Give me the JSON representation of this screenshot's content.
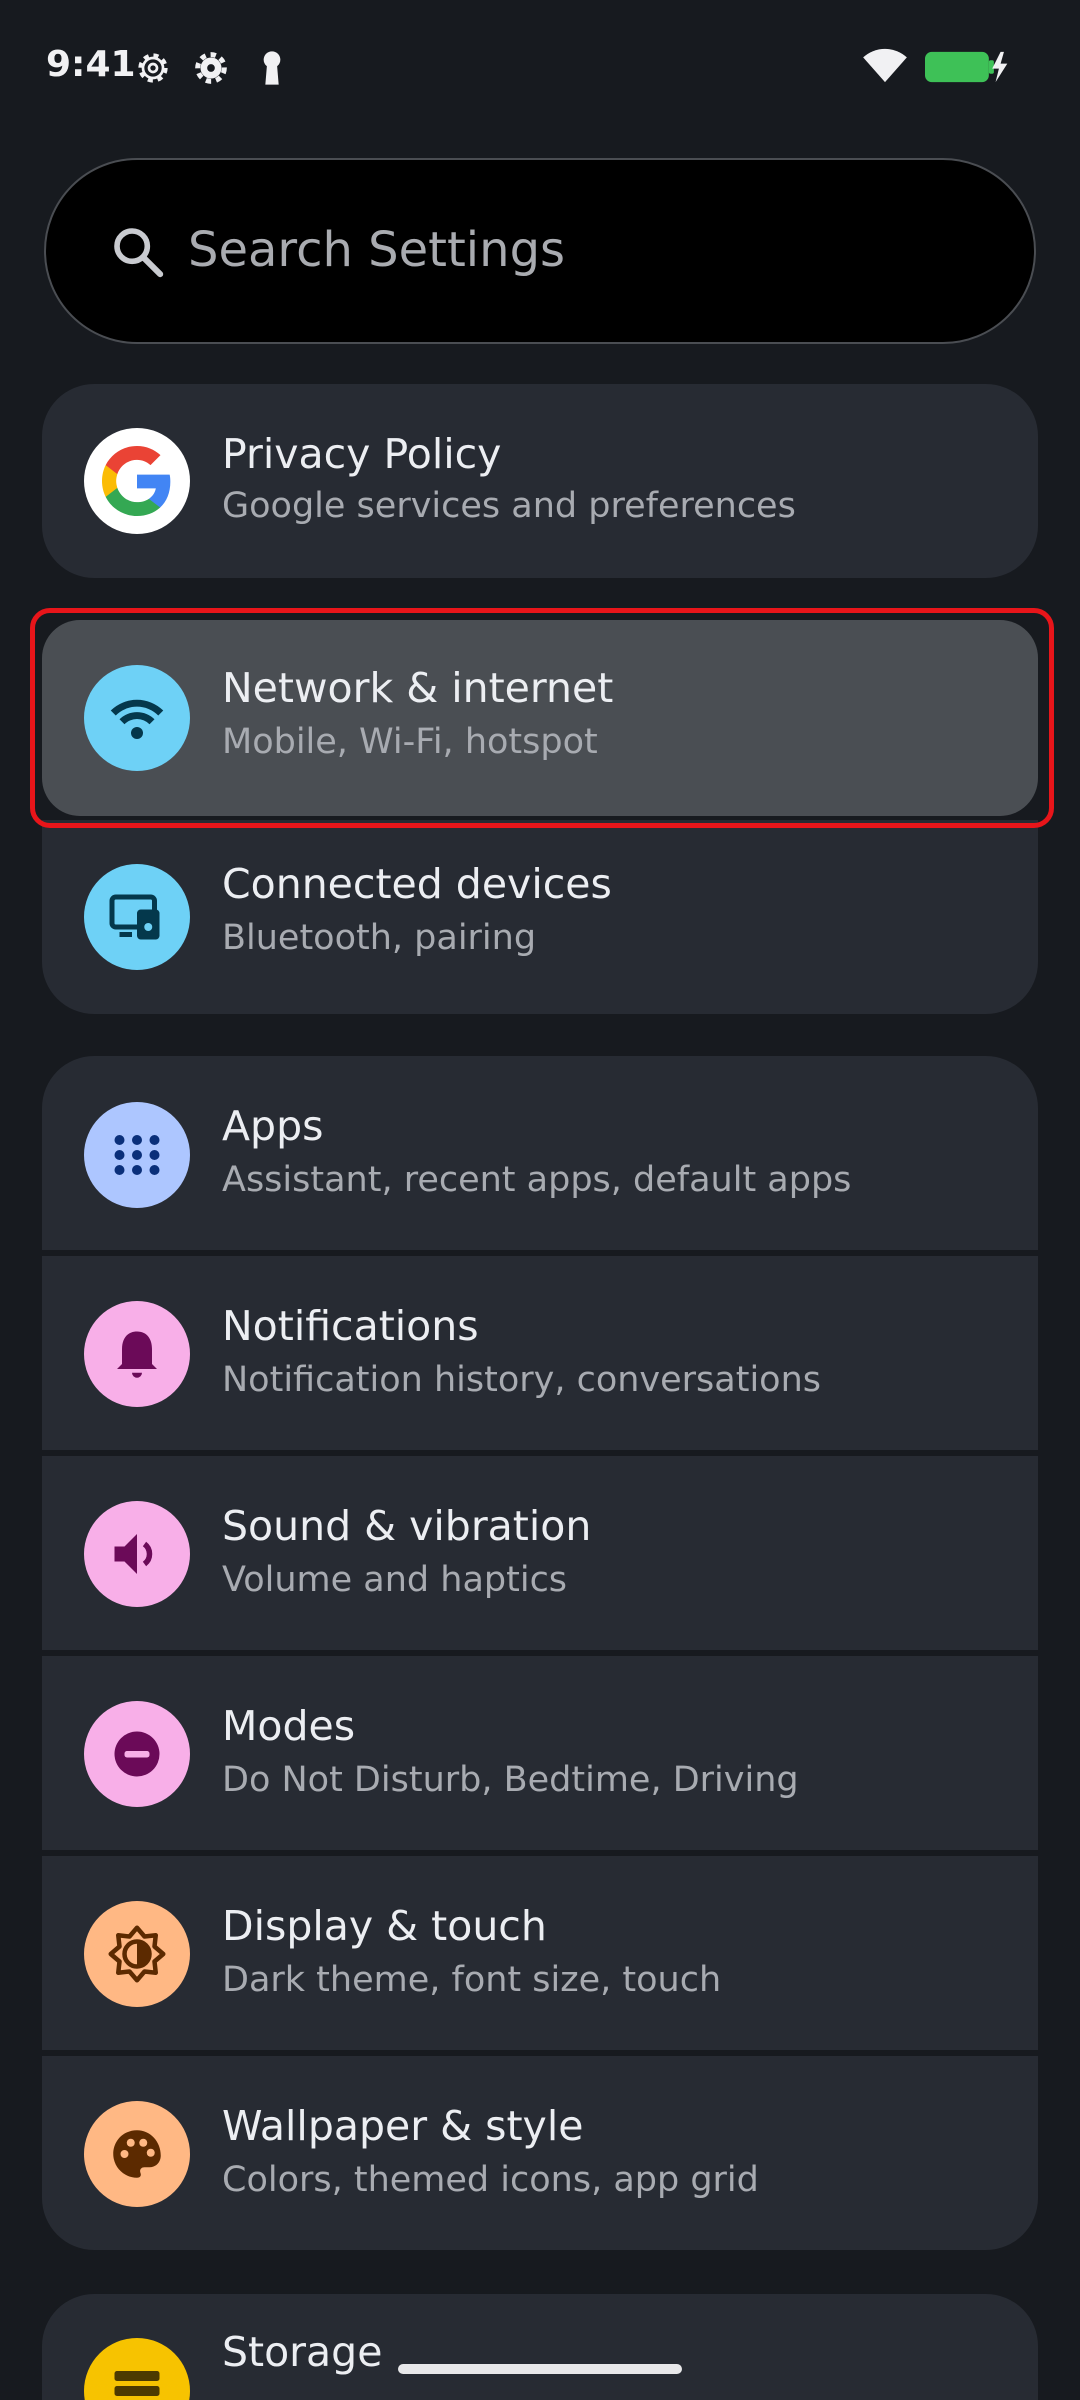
{
  "status_bar": {
    "time": "9:41",
    "icons": [
      "settings-gear-icon",
      "settings-gear-icon",
      "keyhole-icon",
      "wifi-icon",
      "battery-charging-icon"
    ]
  },
  "search": {
    "placeholder": "Search Settings",
    "icon": "search-icon"
  },
  "items": [
    {
      "id": "privacy",
      "title": "Privacy Policy",
      "subtitle": "Google services and preferences",
      "icon": "google-logo-icon"
    },
    {
      "id": "network",
      "title": "Network & internet",
      "subtitle": "Mobile, Wi-Fi, hotspot",
      "icon": "wifi-icon",
      "icon_bg": "#6ed1f6",
      "icon_fg": "#04384c"
    },
    {
      "id": "connected",
      "title": "Connected devices",
      "subtitle": "Bluetooth, pairing",
      "icon": "devices-icon",
      "icon_bg": "#6ed1f6",
      "icon_fg": "#04384c"
    },
    {
      "id": "apps",
      "title": "Apps",
      "subtitle": "Assistant, recent apps, default apps",
      "icon": "apps-grid-icon",
      "icon_bg": "#adc6ff",
      "icon_fg": "#0a2f7a"
    },
    {
      "id": "notifications",
      "title": "Notifications",
      "subtitle": "Notification history, conversations",
      "icon": "bell-icon",
      "icon_bg": "#f8afe8",
      "icon_fg": "#6b0a58"
    },
    {
      "id": "sound",
      "title": "Sound & vibration",
      "subtitle": "Volume and haptics",
      "icon": "speaker-icon",
      "icon_bg": "#f8afe8",
      "icon_fg": "#6b0a58"
    },
    {
      "id": "modes",
      "title": "Modes",
      "subtitle": "Do Not Disturb, Bedtime, Driving",
      "icon": "do-not-disturb-icon",
      "icon_bg": "#f8afe8",
      "icon_fg": "#6b0a58"
    },
    {
      "id": "display",
      "title": "Display & touch",
      "subtitle": "Dark theme, font size, touch",
      "icon": "brightness-icon",
      "icon_bg": "#ffb884",
      "icon_fg": "#5c2a00"
    },
    {
      "id": "wallpaper",
      "title": "Wallpaper & style",
      "subtitle": "Colors, themed icons, app grid",
      "icon": "palette-icon",
      "icon_bg": "#ffb884",
      "icon_fg": "#5c2a00"
    },
    {
      "id": "storage",
      "title": "Storage",
      "subtitle": "",
      "icon": "storage-icon",
      "icon_bg": "#f7c300",
      "icon_fg": "#4d3a00"
    }
  ],
  "highlight_color": "#e8151a"
}
